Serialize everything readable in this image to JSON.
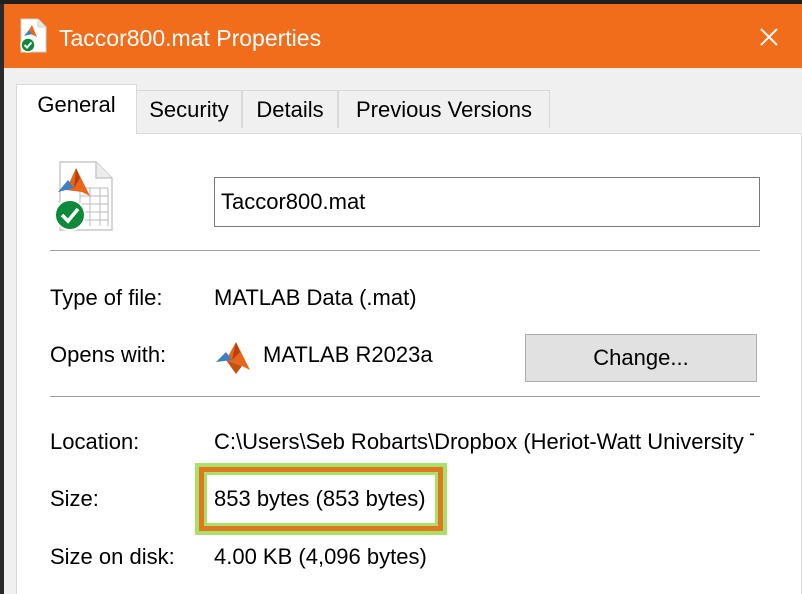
{
  "window": {
    "title": "Taccor800.mat Properties",
    "title_bar_color": "#f26d1b"
  },
  "tabs": [
    {
      "label": "General",
      "active": true
    },
    {
      "label": "Security",
      "active": false
    },
    {
      "label": "Details",
      "active": false
    },
    {
      "label": "Previous Versions",
      "active": false
    }
  ],
  "general": {
    "file_name": "Taccor800.mat",
    "type_of_file": {
      "label": "Type of file:",
      "value": "MATLAB Data (.mat)"
    },
    "opens_with": {
      "label": "Opens with:",
      "value": "MATLAB R2023a",
      "change_button": "Change..."
    },
    "location": {
      "label": "Location:",
      "value": "C:\\Users\\Seb Robarts\\Dropbox (Heriot-Watt University T"
    },
    "size": {
      "label": "Size:",
      "value": "853 bytes (853 bytes)"
    },
    "size_on_disk": {
      "label": "Size on disk:",
      "value": "4.00 KB (4,096 bytes)"
    }
  },
  "icons": {
    "window_icon": "matlab-file-synced-icon",
    "file_icon": "matlab-data-file-icon",
    "sync_badge": "green-check-icon",
    "app_icon": "matlab-logo-icon",
    "close": "close-icon"
  },
  "highlight": {
    "target": "size value",
    "color": "#e07820",
    "glow": "#a8e06a"
  }
}
